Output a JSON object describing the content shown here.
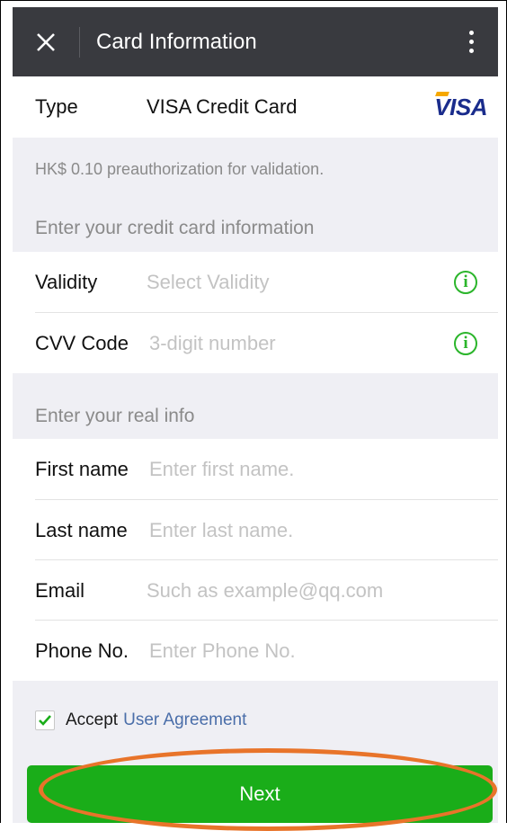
{
  "header": {
    "title": "Card Information"
  },
  "card": {
    "type_label": "Type",
    "type_value": "VISA  Credit Card",
    "brand_logo": "VISA"
  },
  "notes": {
    "preauth": "HK$ 0.10 preauthorization for validation.",
    "card_section": "Enter your credit card information",
    "info_section": "Enter your real info"
  },
  "card_fields": {
    "validity_label": "Validity",
    "validity_placeholder": "Select Validity",
    "cvv_label": "CVV Code",
    "cvv_placeholder": "3-digit number"
  },
  "personal_fields": {
    "first_name_label": "First name",
    "first_name_placeholder": "Enter first name.",
    "last_name_label": "Last name",
    "last_name_placeholder": "Enter last name.",
    "email_label": "Email",
    "email_placeholder": "Such as example@qq.com",
    "phone_label": "Phone No.",
    "phone_placeholder": "Enter Phone No."
  },
  "agreement": {
    "accept": "Accept",
    "link": "User Agreement",
    "checked": true
  },
  "actions": {
    "next": "Next"
  },
  "colors": {
    "header": "#393a3f",
    "accent_green": "#1aad19",
    "link_blue": "#4a6ea9",
    "highlight_ring": "#e8742a"
  },
  "icons": {
    "close": "close-icon",
    "more": "more-vertical-icon",
    "info": "info-icon",
    "check": "check-icon"
  }
}
